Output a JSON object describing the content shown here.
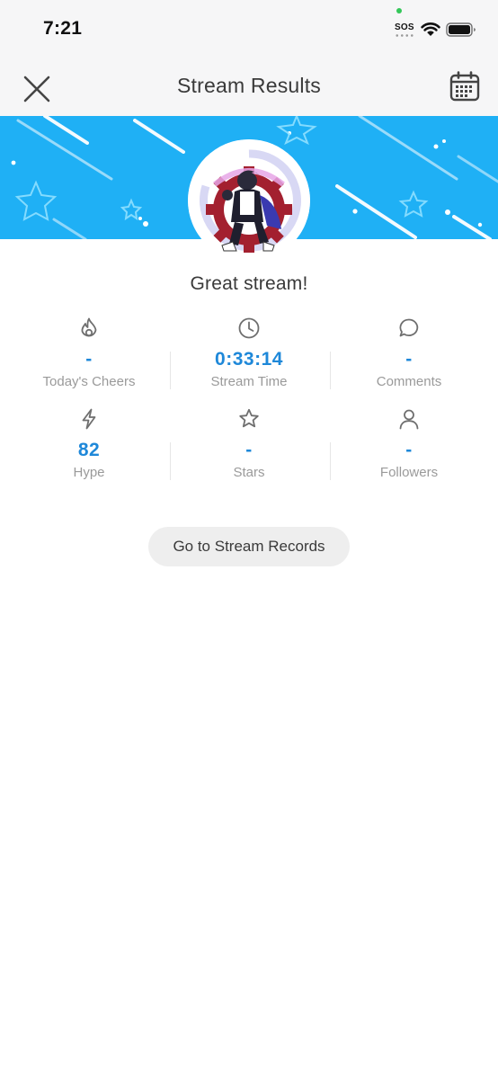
{
  "status_bar": {
    "time": "7:21",
    "sos": "SOS"
  },
  "nav": {
    "title": "Stream Results"
  },
  "headline": "Great stream!",
  "stats": [
    {
      "icon": "flame-icon",
      "value": "-",
      "label": "Today's Cheers"
    },
    {
      "icon": "clock-icon",
      "value": "0:33:14",
      "label": "Stream Time"
    },
    {
      "icon": "comment-icon",
      "value": "-",
      "label": "Comments"
    },
    {
      "icon": "lightning-icon",
      "value": "82",
      "label": "Hype"
    },
    {
      "icon": "star-icon",
      "value": "-",
      "label": "Stars"
    },
    {
      "icon": "person-icon",
      "value": "-",
      "label": "Followers"
    }
  ],
  "records_button": {
    "label": "Go to Stream Records"
  },
  "colors": {
    "accent": "#1e88d9",
    "banner": "#1fb0f5",
    "nav_bg": "#f6f6f7"
  }
}
